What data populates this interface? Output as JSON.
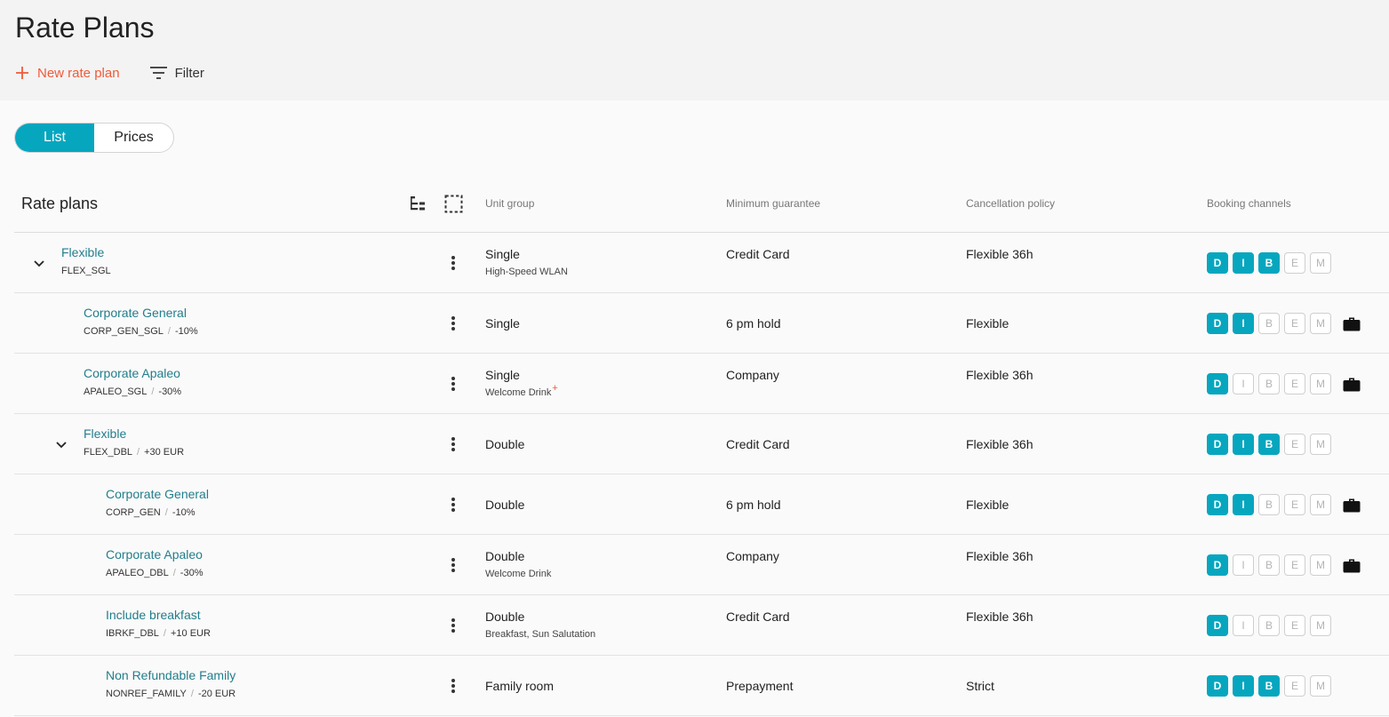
{
  "page": {
    "title": "Rate Plans",
    "new_rate_plan_label": "New rate plan",
    "filter_label": "Filter"
  },
  "view_toggle": {
    "list_label": "List",
    "prices_label": "Prices",
    "active": "List"
  },
  "table": {
    "headers": {
      "rate_plans": "Rate plans",
      "unit_group": "Unit group",
      "minimum_guarantee": "Minimum guarantee",
      "cancellation_policy": "Cancellation policy",
      "booking_channels": "Booking channels"
    },
    "channel_letters": [
      "D",
      "I",
      "B",
      "E",
      "M"
    ],
    "rows": [
      {
        "name": "Flexible",
        "code": "FLEX_SGL",
        "adjustment": "",
        "unit_group": "Single",
        "unit_group_sub": "High-Speed WLAN",
        "sub_marker": "",
        "min_guarantee": "Credit Card",
        "cancellation": "Flexible 36h",
        "channels": [
          true,
          true,
          true,
          false,
          false
        ],
        "corporate": false,
        "level": 0,
        "expandable": true
      },
      {
        "name": "Corporate General",
        "code": "CORP_GEN_SGL",
        "adjustment": "-10%",
        "unit_group": "Single",
        "unit_group_sub": "",
        "sub_marker": "",
        "min_guarantee": "6 pm hold",
        "cancellation": "Flexible",
        "channels": [
          true,
          true,
          false,
          false,
          false
        ],
        "corporate": true,
        "level": 1,
        "expandable": false
      },
      {
        "name": "Corporate Apaleo",
        "code": "APALEO_SGL",
        "adjustment": "-30%",
        "unit_group": "Single",
        "unit_group_sub": "Welcome Drink",
        "sub_marker": "+",
        "min_guarantee": "Company",
        "cancellation": "Flexible 36h",
        "channels": [
          true,
          false,
          false,
          false,
          false
        ],
        "corporate": true,
        "level": 1,
        "expandable": false
      },
      {
        "name": "Flexible",
        "code": "FLEX_DBL",
        "adjustment": "+30 EUR",
        "unit_group": "Double",
        "unit_group_sub": "",
        "sub_marker": "",
        "min_guarantee": "Credit Card",
        "cancellation": "Flexible 36h",
        "channels": [
          true,
          true,
          true,
          false,
          false
        ],
        "corporate": false,
        "level": 1,
        "expandable": true
      },
      {
        "name": "Corporate General",
        "code": "CORP_GEN",
        "adjustment": "-10%",
        "unit_group": "Double",
        "unit_group_sub": "",
        "sub_marker": "",
        "min_guarantee": "6 pm hold",
        "cancellation": "Flexible",
        "channels": [
          true,
          true,
          false,
          false,
          false
        ],
        "corporate": true,
        "level": 2,
        "expandable": false
      },
      {
        "name": "Corporate Apaleo",
        "code": "APALEO_DBL",
        "adjustment": "-30%",
        "unit_group": "Double",
        "unit_group_sub": "Welcome Drink",
        "sub_marker": "",
        "min_guarantee": "Company",
        "cancellation": "Flexible 36h",
        "channels": [
          true,
          false,
          false,
          false,
          false
        ],
        "corporate": true,
        "level": 2,
        "expandable": false
      },
      {
        "name": "Include breakfast",
        "code": "IBRKF_DBL",
        "adjustment": "+10 EUR",
        "unit_group": "Double",
        "unit_group_sub": "Breakfast, Sun Salutation",
        "sub_marker": "",
        "min_guarantee": "Credit Card",
        "cancellation": "Flexible 36h",
        "channels": [
          true,
          false,
          false,
          false,
          false
        ],
        "corporate": false,
        "level": 2,
        "expandable": false
      },
      {
        "name": "Non Refundable Family",
        "code": "NONREF_FAMILY",
        "adjustment": "-20 EUR",
        "unit_group": "Family room",
        "unit_group_sub": "",
        "sub_marker": "",
        "min_guarantee": "Prepayment",
        "cancellation": "Strict",
        "channels": [
          true,
          true,
          true,
          false,
          false
        ],
        "corporate": false,
        "level": 2,
        "expandable": false
      }
    ]
  },
  "colors": {
    "accent": "#07a6bf",
    "link": "#237e8c",
    "new_action": "#f05a3a"
  },
  "icons": {
    "new": "plus-icon",
    "filter": "filter-icon",
    "hierarchy": "hierarchy-icon",
    "select": "select-all-icon",
    "expand": "chevron-down-icon",
    "menu": "more-vert-icon",
    "corporate": "briefcase-icon"
  }
}
